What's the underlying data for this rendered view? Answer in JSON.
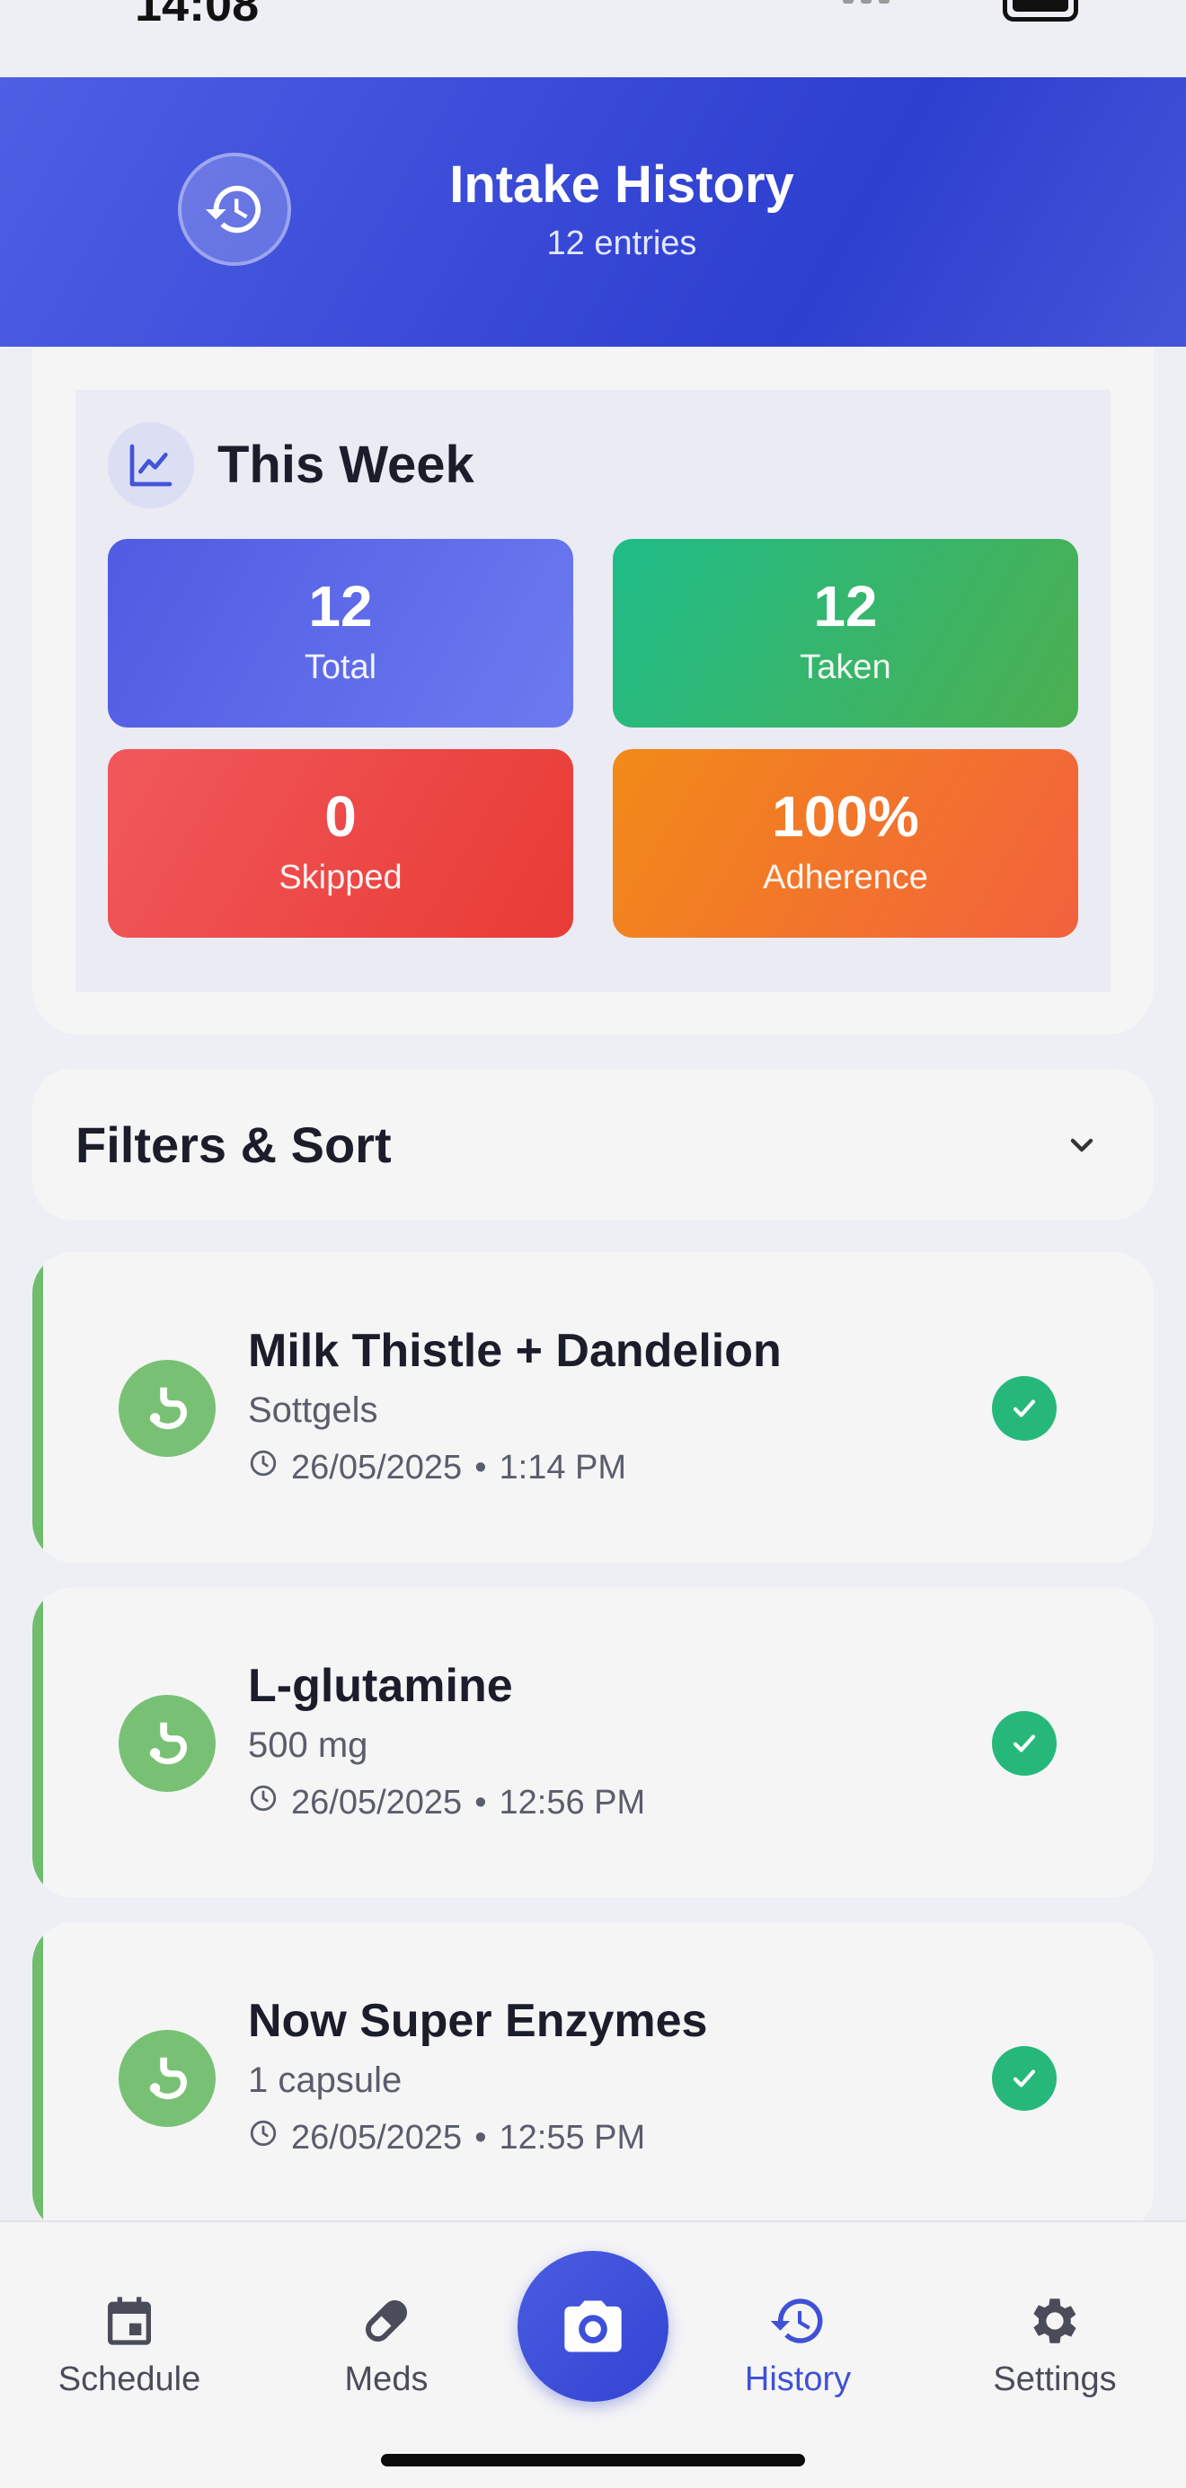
{
  "status_bar": {
    "time": "14:08"
  },
  "header": {
    "title": "Intake History",
    "subtitle": "12 entries"
  },
  "week": {
    "title": "This Week",
    "stats": [
      {
        "value": "12",
        "label": "Total",
        "color": "#5865e6"
      },
      {
        "value": "12",
        "label": "Taken",
        "color": "#22b87f"
      },
      {
        "value": "0",
        "label": "Skipped",
        "color": "#ea4a4a"
      },
      {
        "value": "100%",
        "label": "Adherence",
        "color": "#f0841f"
      }
    ]
  },
  "filters": {
    "title": "Filters & Sort"
  },
  "entries": [
    {
      "name": "Milk Thistle + Dandelion",
      "dose": "Sottgels",
      "date": "26/05/2025",
      "time": "1:14 PM",
      "status": "taken"
    },
    {
      "name": "L-glutamine",
      "dose": "500 mg",
      "date": "26/05/2025",
      "time": "12:56 PM",
      "status": "taken"
    },
    {
      "name": "Now Super Enzymes",
      "dose": "1 capsule",
      "date": "26/05/2025",
      "time": "12:55 PM",
      "status": "taken"
    }
  ],
  "date_time_separator": "•",
  "tabs": [
    {
      "label": "Schedule",
      "icon": "calendar-icon"
    },
    {
      "label": "Meds",
      "icon": "pill-icon"
    },
    {
      "label": "History",
      "icon": "history-icon",
      "active": true
    },
    {
      "label": "Settings",
      "icon": "gear-icon"
    }
  ],
  "colors": {
    "primary": "#3f51d6",
    "taken_green": "#26b87b",
    "accent_bar": "#6fbd6d"
  }
}
